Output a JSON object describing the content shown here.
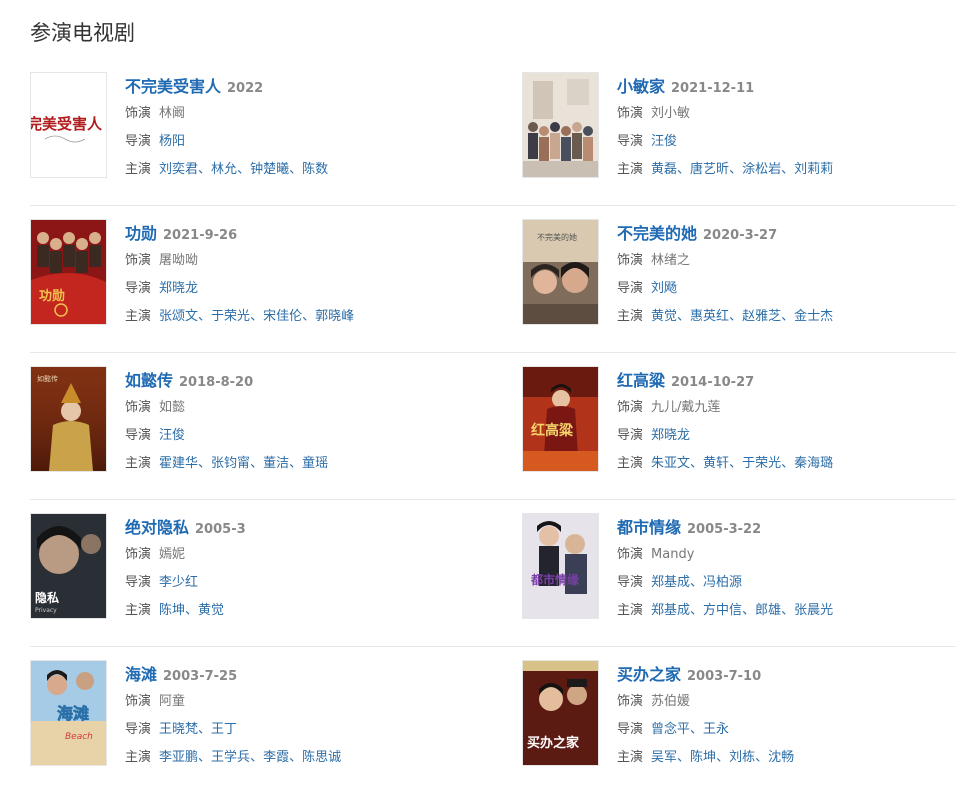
{
  "section": {
    "title": "参演电视剧"
  },
  "labels": {
    "role": "饰演",
    "director": "导演",
    "cast": "主演"
  },
  "colors": {
    "title_link": "#1f6ab3",
    "person_link": "#2c6ea8",
    "date": "#888888",
    "divider": "#e8e8e8"
  },
  "dramas": [
    {
      "title": "不完美受害人",
      "date": "2022",
      "role": "林阚",
      "role_link": false,
      "directors": [
        "杨阳"
      ],
      "cast": [
        "刘奕君",
        "林允",
        "钟楚曦",
        "陈数"
      ]
    },
    {
      "title": "小敏家",
      "date": "2021-12-11",
      "role": "刘小敏",
      "role_link": false,
      "directors": [
        "汪俊"
      ],
      "cast": [
        "黄磊",
        "唐艺昕",
        "涂松岩",
        "刘莉莉"
      ]
    },
    {
      "title": "功勋",
      "date": "2021-9-26",
      "role": "屠呦呦",
      "role_link": false,
      "directors": [
        "郑晓龙"
      ],
      "cast": [
        "张颂文",
        "于荣光",
        "宋佳伦",
        "郭晓峰"
      ]
    },
    {
      "title": "不完美的她",
      "date": "2020-3-27",
      "role": "林绪之",
      "role_link": false,
      "directors": [
        "刘飏"
      ],
      "cast": [
        "黄觉",
        "惠英红",
        "赵雅芝",
        "金士杰"
      ]
    },
    {
      "title": "如懿传",
      "date": "2018-8-20",
      "role": "如懿",
      "role_link": false,
      "directors": [
        "汪俊"
      ],
      "cast": [
        "霍建华",
        "张钧甯",
        "董洁",
        "童瑶"
      ]
    },
    {
      "title": "红高粱",
      "date": "2014-10-27",
      "role": "九儿/戴九莲",
      "role_link": false,
      "directors": [
        "郑晓龙"
      ],
      "cast": [
        "朱亚文",
        "黄轩",
        "于荣光",
        "秦海璐"
      ]
    },
    {
      "title": "绝对隐私",
      "date": "2005-3",
      "role": "嫣妮",
      "role_link": false,
      "directors": [
        "李少红"
      ],
      "cast": [
        "陈坤",
        "黄觉"
      ]
    },
    {
      "title": "都市情缘",
      "date": "2005-3-22",
      "role": "Mandy",
      "role_link": false,
      "directors": [
        "郑基成",
        "冯柏源"
      ],
      "cast": [
        "郑基成",
        "方中信",
        "郎雄",
        "张晨光"
      ]
    },
    {
      "title": "海滩",
      "date": "2003-7-25",
      "role": "阿童",
      "role_link": false,
      "directors": [
        "王晓梵",
        "王丁"
      ],
      "cast": [
        "李亚鹏",
        "王学兵",
        "李霞",
        "陈思诚"
      ]
    },
    {
      "title": "买办之家",
      "date": "2003-7-10",
      "role": "苏伯媛",
      "role_link": false,
      "directors": [
        "曾念平",
        "王永"
      ],
      "cast": [
        "吴军",
        "陈坤",
        "刘栋",
        "沈畅"
      ]
    }
  ],
  "posters": [
    {
      "kind": "text-poster",
      "text": "完美受害人",
      "bg": "#ffffff",
      "fg": "#b01c1c"
    },
    {
      "kind": "family",
      "bg": "#e9e2d8"
    },
    {
      "kind": "red-group",
      "bg": "#8c1616"
    },
    {
      "kind": "portrait-pair",
      "bg": "#d8c9b0"
    },
    {
      "kind": "palace",
      "bg": "#7a2d12"
    },
    {
      "kind": "sorghum",
      "bg": "#b1331a"
    },
    {
      "kind": "dark-portrait",
      "text": "隐私",
      "bg": "#2a2f35"
    },
    {
      "kind": "city-couple",
      "text": "都市情缘",
      "bg": "#e7e3ea"
    },
    {
      "kind": "beach",
      "text": "海滩",
      "bg": "#a6cbe6"
    },
    {
      "kind": "house",
      "text": "买办之家",
      "bg": "#5b1a12"
    }
  ]
}
